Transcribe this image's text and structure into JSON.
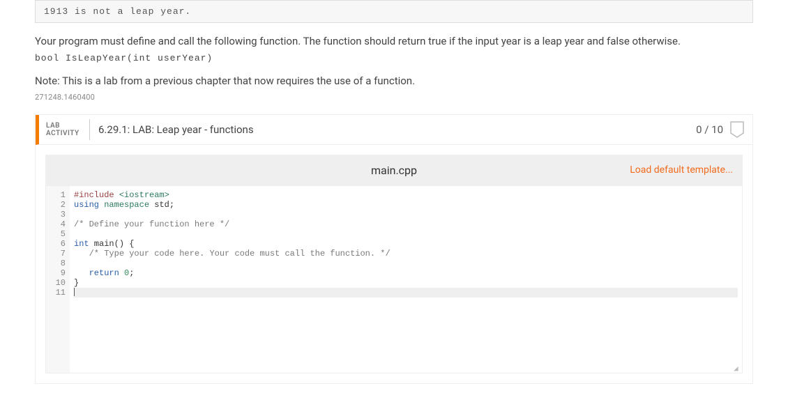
{
  "output_block": "1913 is not a leap year.",
  "instructions": {
    "para1": "Your program must define and call the following function. The function should return true if the input year is a leap year and false otherwise.",
    "signature": "bool IsLeapYear(int userYear)",
    "note": "Note: This is a lab from a previous chapter that now requires the use of a function.",
    "id_code": "271248.1460400"
  },
  "activity": {
    "label_line1": "LAB",
    "label_line2": "ACTIVITY",
    "title": "6.29.1: LAB: Leap year - functions",
    "score": "0 / 10"
  },
  "editor": {
    "filename": "main.cpp",
    "load_template_label": "Load default template...",
    "lines": [
      {
        "n": 1,
        "raw": "#include <iostream>",
        "html": "<span class='tok-pp'>#include</span> <span class='tok-inc'>&lt;iostream&gt;</span>"
      },
      {
        "n": 2,
        "raw": "using namespace std;",
        "html": "<span class='tok-kw'>using</span> <span class='tok-inc'>namespace</span> std;"
      },
      {
        "n": 3,
        "raw": "",
        "html": ""
      },
      {
        "n": 4,
        "raw": "/* Define your function here */",
        "html": "<span class='tok-cmt'>/* Define your function here */</span>"
      },
      {
        "n": 5,
        "raw": "",
        "html": ""
      },
      {
        "n": 6,
        "raw": "int main() {",
        "html": "<span class='tok-kw'>int</span> main() {"
      },
      {
        "n": 7,
        "raw": "   /* Type your code here. Your code must call the function. */",
        "html": "   <span class='tok-cmt'>/* Type your code here. Your code must call the function. */</span>"
      },
      {
        "n": 8,
        "raw": "",
        "html": ""
      },
      {
        "n": 9,
        "raw": "   return 0;",
        "html": "   <span class='tok-kw'>return</span> <span class='tok-num'>0</span>;"
      },
      {
        "n": 10,
        "raw": "}",
        "html": "}"
      },
      {
        "n": 11,
        "raw": "",
        "html": "<span class='cursor-caret'></span>",
        "cursor": true
      }
    ]
  }
}
